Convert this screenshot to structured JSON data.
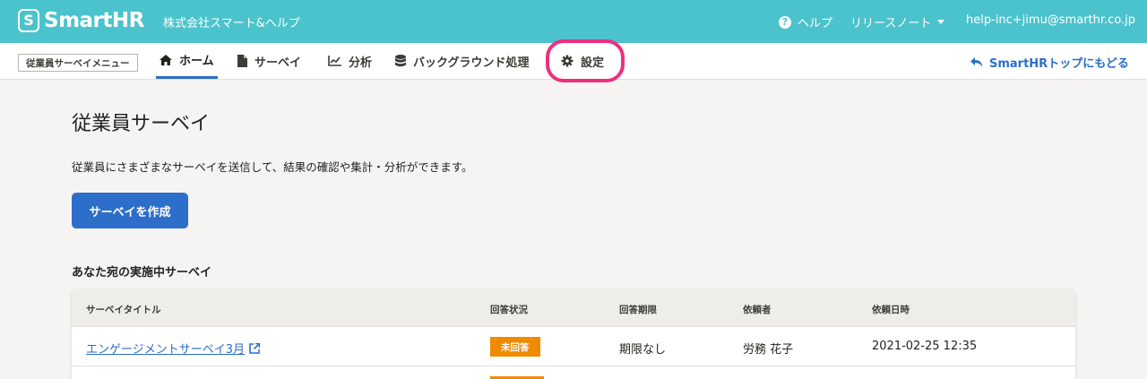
{
  "header": {
    "logo_mark": "S",
    "logo_text": "SmartHR",
    "company": "株式会社スマート&ヘルプ",
    "help_label": "ヘルプ",
    "release_notes_label": "リリースノート",
    "user_email": "help-inc+jimu@smarthr.co.jp"
  },
  "subnav": {
    "menu_badge": "従業員サーベイメニュー",
    "items": [
      {
        "label": "ホーム",
        "icon": "home-icon",
        "active": true
      },
      {
        "label": "サーベイ",
        "icon": "document-icon"
      },
      {
        "label": "分析",
        "icon": "chart-icon"
      },
      {
        "label": "バックグラウンド処理",
        "icon": "database-icon"
      },
      {
        "label": "設定",
        "icon": "gear-icon",
        "highlighted": true
      }
    ],
    "back_link": "SmartHRトップにもどる"
  },
  "main": {
    "title": "従業員サーベイ",
    "description": "従業員にさまざまなサーベイを送信して、結果の確認や集計・分析ができます。",
    "create_button": "サーベイを作成",
    "section_title": "あなた宛の実施中サーベイ"
  },
  "table": {
    "columns": [
      "サーベイタイトル",
      "回答状況",
      "回答期限",
      "依頼者",
      "依頼日時"
    ],
    "rows": [
      {
        "title": "エンゲージメントサーベイ3月",
        "status": "未回答",
        "deadline": "期限なし",
        "requester": "労務 花子",
        "requested_at": "2021-02-25 12:35"
      }
    ]
  },
  "colors": {
    "header_bg": "#4bc3cc",
    "accent": "#2c6ec9",
    "highlight": "#ee2f7d",
    "status_unanswered": "#f08a00"
  }
}
